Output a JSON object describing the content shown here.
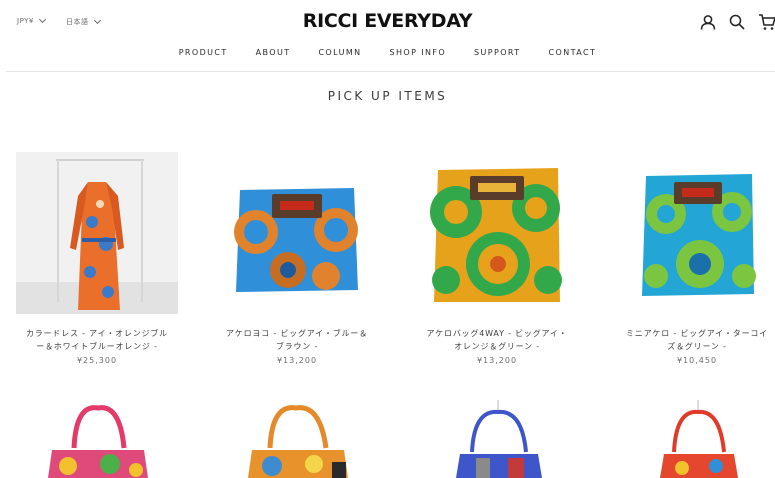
{
  "header": {
    "currency": "JPY¥",
    "language": "日本語",
    "logo": "RICCI EVERYDAY",
    "icons": [
      "account-icon",
      "search-icon",
      "cart-icon"
    ]
  },
  "nav": {
    "items": [
      "PRODUCT",
      "ABOUT",
      "COLUMN",
      "SHOP INFO",
      "SUPPORT",
      "CONTACT"
    ]
  },
  "section": {
    "title": "PICK UP ITEMS"
  },
  "products": [
    {
      "name_line1": "カラードレス - アイ・オレンジブル",
      "name_line2": "ー＆ホワイトブルーオレンジ -",
      "price": "¥25,300"
    },
    {
      "name_line1": "アケロヨコ - ビッグアイ・ブルー＆",
      "name_line2": "ブラウン -",
      "price": "¥13,200"
    },
    {
      "name_line1": "アケロバッグ4WAY - ビッグアイ・",
      "name_line2": "オレンジ＆グリーン -",
      "price": "¥13,200"
    },
    {
      "name_line1": "ミニアケロ - ビッグアイ・ターコイ",
      "name_line2": "ズ＆グリーン -",
      "price": "¥10,450"
    }
  ],
  "colors": {
    "text": "#1c1b1b",
    "divider": "#e6e6e6"
  }
}
